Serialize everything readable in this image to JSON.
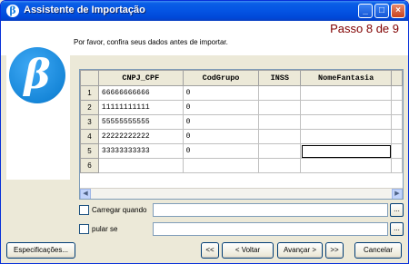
{
  "window": {
    "title": "Assistente de Importação",
    "minimize": "_",
    "maximize": "□",
    "close": "×"
  },
  "header": {
    "step": "Passo 8 de 9",
    "instruction": "Por favor, confira seus dados antes de importar."
  },
  "logo": {
    "letter": "β"
  },
  "grid": {
    "columns": [
      "CNPJ_CPF",
      "CodGrupo",
      "INSS",
      "NomeFantasia"
    ],
    "rows": [
      {
        "num": "1",
        "cnpj": "66666666666",
        "cod": "0",
        "inss": "",
        "nome": ""
      },
      {
        "num": "2",
        "cnpj": "11111111111",
        "cod": "0",
        "inss": "",
        "nome": ""
      },
      {
        "num": "3",
        "cnpj": "55555555555",
        "cod": "0",
        "inss": "",
        "nome": ""
      },
      {
        "num": "4",
        "cnpj": "22222222222",
        "cod": "0",
        "inss": "",
        "nome": ""
      },
      {
        "num": "5",
        "cnpj": "33333333333",
        "cod": "0",
        "inss": "",
        "nome": ""
      },
      {
        "num": "6",
        "cnpj": "",
        "cod": "",
        "inss": "",
        "nome": ""
      }
    ],
    "scroll_left": "◀",
    "scroll_right": "▶"
  },
  "options": {
    "carregar_label": "Carregar quando",
    "pular_label": "pular se",
    "browse": "..."
  },
  "buttons": {
    "especificacoes": "Especificações...",
    "first": "<<",
    "voltar": "< Voltar",
    "avancar": "Avançar >",
    "last": ">>",
    "cancelar": "Cancelar"
  }
}
